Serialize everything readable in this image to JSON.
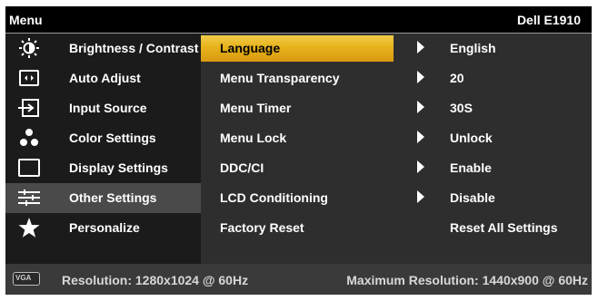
{
  "header": {
    "title": "Menu",
    "model": "Dell  E1910"
  },
  "main_menu": [
    {
      "icon": "brightness-icon",
      "label": "Brightness / Contrast"
    },
    {
      "icon": "auto-adjust-icon",
      "label": "Auto Adjust"
    },
    {
      "icon": "input-source-icon",
      "label": "Input Source"
    },
    {
      "icon": "color-settings-icon",
      "label": "Color Settings"
    },
    {
      "icon": "display-settings-icon",
      "label": "Display Settings"
    },
    {
      "icon": "other-settings-icon",
      "label": "Other Settings",
      "selected": true
    },
    {
      "icon": "star-icon",
      "label": "Personalize"
    }
  ],
  "submenu": [
    {
      "label": "Language",
      "value": "English",
      "has_arrow": true,
      "highlighted": true
    },
    {
      "label": "Menu Transparency",
      "value": "20",
      "has_arrow": true
    },
    {
      "label": "Menu Timer",
      "value": "30S",
      "has_arrow": true
    },
    {
      "label": "Menu Lock",
      "value": "Unlock",
      "has_arrow": true
    },
    {
      "label": "DDC/CI",
      "value": "Enable",
      "has_arrow": true
    },
    {
      "label": "LCD Conditioning",
      "value": "Disable",
      "has_arrow": true
    },
    {
      "label": "Factory Reset",
      "value": "Reset All Settings",
      "has_arrow": false
    }
  ],
  "status": {
    "connector": "VGA",
    "resolution": "Resolution: 1280x1024 @ 60Hz",
    "max_resolution": "Maximum Resolution: 1440x900 @ 60Hz"
  },
  "colors": {
    "highlight": "#e6b21a",
    "selected_item": "#4a4a4a",
    "left_panel": "#1b1b1b",
    "right_panel": "#2e2e2e"
  }
}
